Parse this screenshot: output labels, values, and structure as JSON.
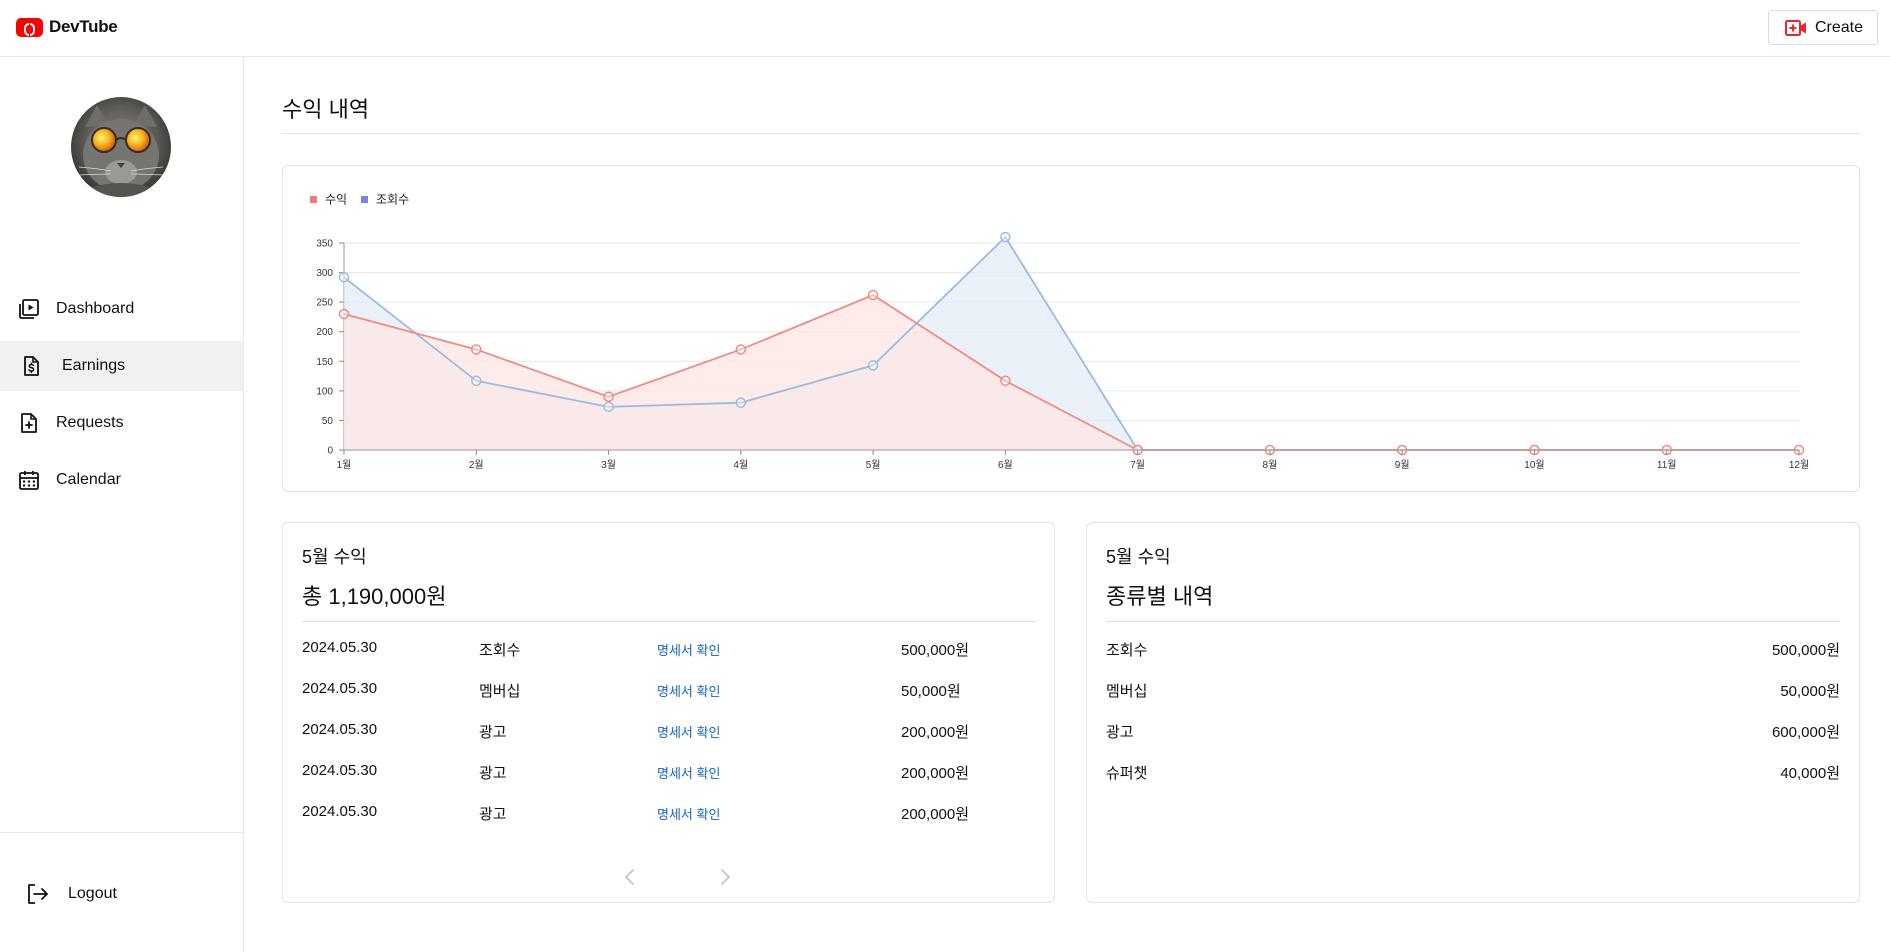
{
  "app": {
    "title": "DevTube",
    "create_label": "Create"
  },
  "sidebar": {
    "items": [
      {
        "label": "Dashboard",
        "icon": "video-library-icon"
      },
      {
        "label": "Earnings",
        "icon": "dollar-document-icon",
        "active": true
      },
      {
        "label": "Requests",
        "icon": "document-plus-icon"
      },
      {
        "label": "Calendar",
        "icon": "calendar-icon"
      }
    ],
    "logout_label": "Logout"
  },
  "page": {
    "title": "수익 내역"
  },
  "chart_data": {
    "type": "area",
    "categories": [
      "1월",
      "2월",
      "3월",
      "4월",
      "5월",
      "6월",
      "7월",
      "8월",
      "9월",
      "10월",
      "11월",
      "12월"
    ],
    "series": [
      {
        "name": "수익",
        "color": "#f08c84",
        "fill": "#fde6e4",
        "values": [
          230,
          170,
          90,
          170,
          262,
          117,
          0,
          0,
          0,
          0,
          0,
          0
        ]
      },
      {
        "name": "조회수",
        "color": "#9bbbe0",
        "fill": "#e3ecf5",
        "values": [
          292,
          117,
          73,
          80,
          143,
          360,
          0,
          null,
          null,
          null,
          null,
          null
        ]
      }
    ],
    "legend_colors": [
      "#f47a72",
      "#7b7fe6"
    ],
    "y_ticks": [
      0,
      50,
      100,
      150,
      200,
      250,
      300,
      350
    ],
    "ylim": [
      0,
      350
    ],
    "grid": true,
    "legend": "top-left"
  },
  "earnings_card": {
    "subtitle": "5월 수익",
    "total": "총 1,190,000원",
    "rows": [
      {
        "date": "2024.05.30",
        "type": "조회수",
        "link": "명세서 확인",
        "amount": "500,000원"
      },
      {
        "date": "2024.05.30",
        "type": "멤버십",
        "link": "명세서 확인",
        "amount": "50,000원"
      },
      {
        "date": "2024.05.30",
        "type": "광고",
        "link": "명세서 확인",
        "amount": "200,000원"
      },
      {
        "date": "2024.05.30",
        "type": "광고",
        "link": "명세서 확인",
        "amount": "200,000원"
      },
      {
        "date": "2024.05.30",
        "type": "광고",
        "link": "명세서 확인",
        "amount": "200,000원"
      }
    ]
  },
  "category_card": {
    "subtitle": "5월 수익",
    "title": "종류별 내역",
    "rows": [
      {
        "name": "조회수",
        "amount": "500,000원"
      },
      {
        "name": "멤버십",
        "amount": "50,000원"
      },
      {
        "name": "광고",
        "amount": "600,000원"
      },
      {
        "name": "슈퍼챗",
        "amount": "40,000원"
      }
    ]
  }
}
